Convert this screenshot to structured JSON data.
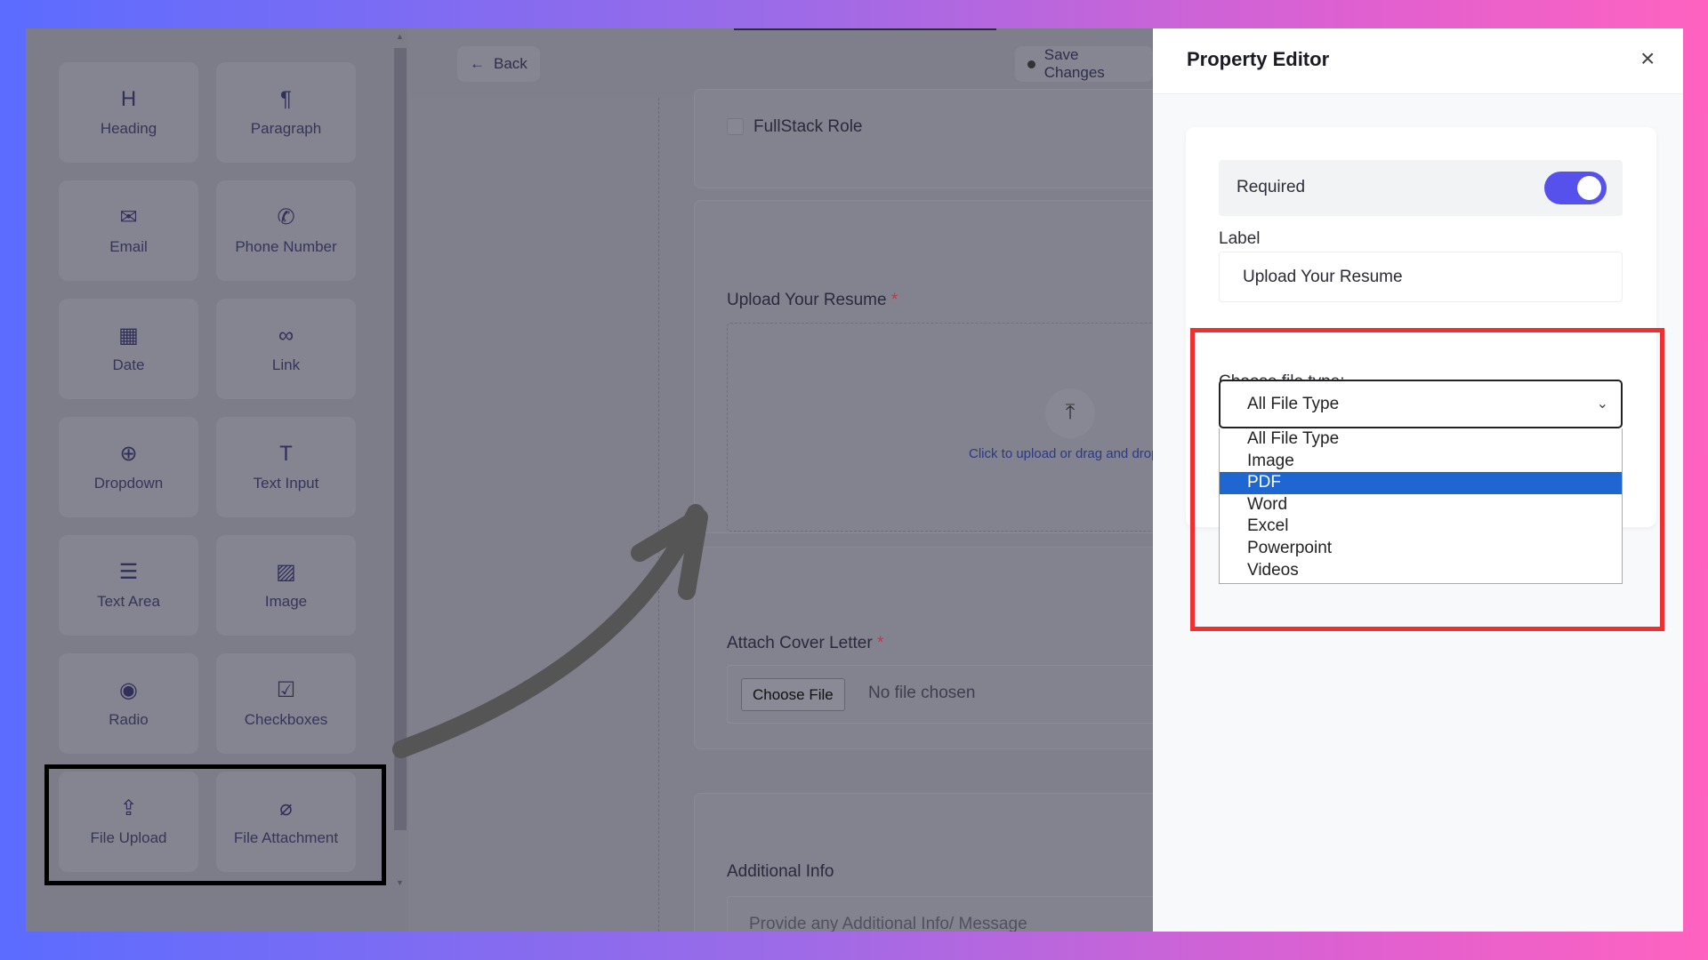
{
  "sidebar": {
    "items": [
      {
        "label": "Heading",
        "icon": "heading-icon",
        "glyph": "H"
      },
      {
        "label": "Paragraph",
        "icon": "paragraph-icon",
        "glyph": "¶"
      },
      {
        "label": "Email",
        "icon": "email-icon",
        "glyph": "✉"
      },
      {
        "label": "Phone Number",
        "icon": "phone-icon",
        "glyph": "✆"
      },
      {
        "label": "Date",
        "icon": "calendar-icon",
        "glyph": "▦"
      },
      {
        "label": "Link",
        "icon": "link-icon",
        "glyph": "∞"
      },
      {
        "label": "Dropdown",
        "icon": "dropdown-icon",
        "glyph": "⊕"
      },
      {
        "label": "Text Input",
        "icon": "text-input-icon",
        "glyph": "T"
      },
      {
        "label": "Text Area",
        "icon": "text-area-icon",
        "glyph": "☰"
      },
      {
        "label": "Image",
        "icon": "image-icon",
        "glyph": "▨"
      },
      {
        "label": "Radio",
        "icon": "radio-icon",
        "glyph": "◉"
      },
      {
        "label": "Checkboxes",
        "icon": "checkbox-icon",
        "glyph": "☑"
      },
      {
        "label": "File Upload",
        "icon": "file-upload-icon",
        "glyph": "⇪"
      },
      {
        "label": "File Attachment",
        "icon": "paperclip-icon",
        "glyph": "⌀"
      }
    ]
  },
  "toolbar": {
    "back": "Back",
    "save": "Save Changes"
  },
  "form": {
    "checkbox_option": "FullStack Role",
    "resume_label": "Upload Your Resume",
    "required_mark": "*",
    "dropzone_text": "Click to upload or drag and drop",
    "cover_label": "Attach Cover Letter",
    "choose_file": "Choose File",
    "no_file": "No file chosen",
    "additional_label": "Additional Info",
    "additional_placeholder": "Provide any Additional Info/ Message"
  },
  "editor": {
    "title": "Property Editor",
    "close": "×",
    "required_label": "Required",
    "required_on": true,
    "label_heading": "Label",
    "label_value": "Upload Your Resume",
    "file_type_heading": "Choose file type:",
    "file_type_selected": "All File Type",
    "file_type_options": [
      "All File Type",
      "Image",
      "PDF",
      "Word",
      "Excel",
      "Powerpoint",
      "Videos"
    ],
    "highlighted_option": "PDF"
  },
  "colors": {
    "accent": "#5650ec",
    "highlight": "#1e67d0",
    "annotation_red": "#f03030"
  }
}
